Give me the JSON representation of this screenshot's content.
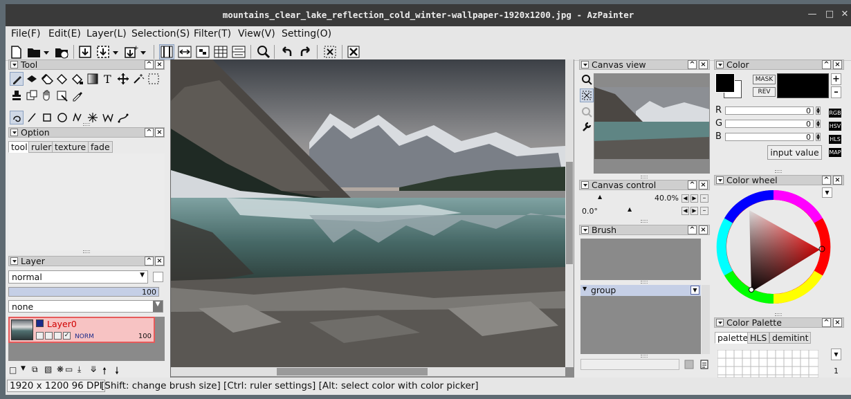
{
  "window": {
    "title": "mountains_clear_lake_reflection_cold_winter-wallpaper-1920x1200.jpg - AzPainter",
    "minimize_icon": "minimize-icon",
    "maximize_icon": "maximize-icon",
    "close_icon": "close-icon"
  },
  "menu": [
    "File(F)",
    "Edit(E)",
    "Layer(L)",
    "Selection(S)",
    "Filter(T)",
    "View(V)",
    "Setting(O)"
  ],
  "tool_panel": {
    "title": "Tool"
  },
  "option_panel": {
    "title": "Option",
    "tabs": [
      "tool",
      "ruler",
      "texture",
      "fade"
    ]
  },
  "layer_panel": {
    "title": "Layer",
    "blend_mode": "normal",
    "opacity": "100",
    "texture": "none",
    "layer": {
      "name": "Layer0",
      "mode": "NORM",
      "opacity": "100"
    }
  },
  "canvas_view": {
    "title": "Canvas view"
  },
  "canvas_control": {
    "title": "Canvas control",
    "zoom": "40.0%",
    "angle": "0.0°"
  },
  "brush_panel": {
    "title": "Brush",
    "group": "group"
  },
  "color_panel": {
    "title": "Color",
    "mask_label": "MASK",
    "rev_label": "REV",
    "channels": [
      {
        "label": "R",
        "value": "0"
      },
      {
        "label": "G",
        "value": "0"
      },
      {
        "label": "B",
        "value": "0"
      }
    ],
    "modes": [
      "RGB",
      "HSV",
      "HLS",
      "MAP"
    ],
    "input_value_label": "input value",
    "accent": "#000000"
  },
  "color_wheel": {
    "title": "Color wheel"
  },
  "color_palette": {
    "title": "Color Palette",
    "tabs": [
      "palette",
      "HLS",
      "demitint"
    ],
    "page": "1"
  },
  "status": {
    "dims": "1920 x 1200 96 DPI",
    "hint": "[Shift: change brush size] [Ctrl: ruler settings] [Alt: select color with color picker]"
  }
}
